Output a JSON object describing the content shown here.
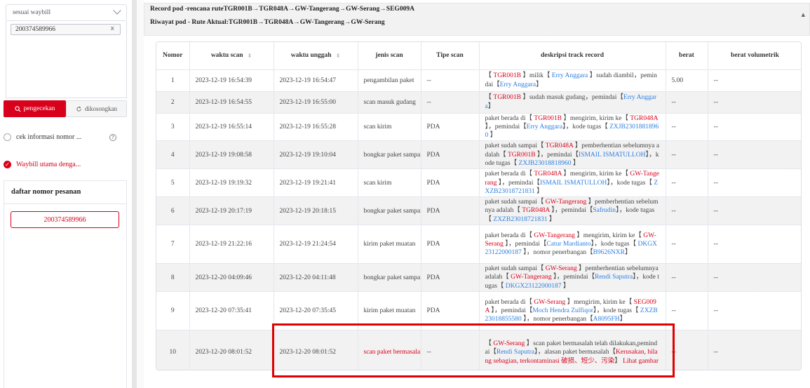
{
  "left": {
    "search_mode": "sesuai waybill",
    "waybill_tag": "200374589966",
    "tag_close": "x",
    "search_btn": "pengecekan",
    "clear_btn": "dikosongkan",
    "option1": "cek informasi nomor ...",
    "option2": "Waybill utama denga...",
    "order_title": "daftar nomor pesanan",
    "order_item": "200374589966"
  },
  "route": {
    "plan": "Record pod -rencana ruteTGR001B→TGR048A→GW-Tangerang→GW-Serang→SEG009A",
    "actual": "Riwayat pod - Rute Aktual:TGR001B→TGR048A→GW-Tangerang→GW-Serang"
  },
  "table": {
    "headers": {
      "nomor": "Nomor",
      "waktu_scan": "waktu scan",
      "waktu_unggah": "waktu unggah",
      "jenis_scan": "jenis scan",
      "tipe_scan": "Tipe scan",
      "deskripsi": "deskripsi track record",
      "berat": "berat",
      "berat_vol": "berat volumetrik"
    },
    "rows": [
      {
        "no": "1",
        "scan": "2023-12-19 16:54:39",
        "unggah": "2023-12-19 16:54:47",
        "jenis": "pengambilan paket",
        "tipe": "--",
        "berat": "5.00",
        "vol": "--",
        "desc": [
          [
            "t",
            "【 "
          ],
          [
            "r",
            "TGR001B"
          ],
          [
            "t",
            " 】milik【 "
          ],
          [
            "b",
            "Erry Anggara"
          ],
          [
            "t",
            " 】sudah diambil，pemindai【"
          ],
          [
            "b",
            "Erry Anggara"
          ],
          [
            "t",
            "】"
          ]
        ]
      },
      {
        "no": "2",
        "scan": "2023-12-19 16:54:55",
        "unggah": "2023-12-19 16:55:00",
        "jenis": "scan masuk gudang",
        "tipe": "--",
        "berat": "--",
        "vol": "--",
        "desc": [
          [
            "t",
            "【 "
          ],
          [
            "r",
            "TGR001B"
          ],
          [
            "t",
            " 】sudah masuk gudang，pemindai【"
          ],
          [
            "b",
            "Erry Anggara"
          ],
          [
            "t",
            "】"
          ]
        ]
      },
      {
        "no": "3",
        "scan": "2023-12-19 16:55:14",
        "unggah": "2023-12-19 16:55:28",
        "jenis": "scan kirim",
        "tipe": "PDA",
        "berat": "--",
        "vol": "--",
        "desc": [
          [
            "t",
            "paket berada di【 "
          ],
          [
            "r",
            "TGR001B"
          ],
          [
            "t",
            " 】mengirim, kirim ke【 "
          ],
          [
            "r",
            "TGR048A"
          ],
          [
            "t",
            " 】，pemindai【"
          ],
          [
            "b",
            "Erry Anggara"
          ],
          [
            "t",
            "】，kode tugas【 "
          ],
          [
            "b",
            "ZXJB23018818960"
          ],
          [
            "t",
            " 】"
          ]
        ]
      },
      {
        "no": "4",
        "scan": "2023-12-19 19:08:58",
        "unggah": "2023-12-19 19:10:04",
        "jenis": "bongkar paket sampai",
        "tipe": "PDA",
        "berat": "--",
        "vol": "--",
        "desc": [
          [
            "t",
            "paket sudah sampai【 "
          ],
          [
            "r",
            "TGR048A"
          ],
          [
            "t",
            " 】pemberhentian sebelumnya adalah【 "
          ],
          [
            "r",
            "TGR001B"
          ],
          [
            "t",
            " 】，pemindai【"
          ],
          [
            "b",
            "ISMAIL ISMATULLOH"
          ],
          [
            "t",
            "】，kode tugas【 "
          ],
          [
            "b",
            "ZXJB23018818960"
          ],
          [
            "t",
            " 】"
          ]
        ]
      },
      {
        "no": "5",
        "scan": "2023-12-19 19:19:32",
        "unggah": "2023-12-19 19:21:41",
        "jenis": "scan kirim",
        "tipe": "PDA",
        "berat": "--",
        "vol": "--",
        "desc": [
          [
            "t",
            "paket berada di【 "
          ],
          [
            "r",
            "TGR048A"
          ],
          [
            "t",
            " 】mengirim, kirim ke【 "
          ],
          [
            "r",
            "GW-Tangerang"
          ],
          [
            "t",
            " 】，pemindai【"
          ],
          [
            "b",
            "ISMAIL ISMATULLOH"
          ],
          [
            "t",
            "】，kode tugas【 "
          ],
          [
            "b",
            "ZXZB23018721831"
          ],
          [
            "t",
            " 】"
          ]
        ]
      },
      {
        "no": "6",
        "scan": "2023-12-19 20:17:19",
        "unggah": "2023-12-19 20:18:15",
        "jenis": "bongkar paket sampai",
        "tipe": "PDA",
        "berat": "--",
        "vol": "--",
        "desc": [
          [
            "t",
            "paket sudah sampai【 "
          ],
          [
            "r",
            "GW-Tangerang"
          ],
          [
            "t",
            " 】pemberhentian sebelumnya adalah【 "
          ],
          [
            "r",
            "TGR048A"
          ],
          [
            "t",
            " 】，pemindai【"
          ],
          [
            "b",
            "Safrudin"
          ],
          [
            "t",
            "】，kode tugas【 "
          ],
          [
            "b",
            "ZXZB23018721831"
          ],
          [
            "t",
            " 】"
          ]
        ]
      },
      {
        "no": "7",
        "scan": "2023-12-19 21:22:16",
        "unggah": "2023-12-19 21:24:54",
        "jenis": "kirim paket muatan",
        "tipe": "PDA",
        "berat": "--",
        "vol": "--",
        "desc": [
          [
            "t",
            "paket berada di【 "
          ],
          [
            "r",
            "GW-Tangerang"
          ],
          [
            "t",
            " 】mengirim, kirim ke【 "
          ],
          [
            "r",
            "GW-Serang"
          ],
          [
            "t",
            " 】，pemindai【"
          ],
          [
            "b",
            "Catur Mardianto"
          ],
          [
            "t",
            "】，kode tugas【 "
          ],
          [
            "b",
            "DKGX23122000187"
          ],
          [
            "t",
            " 】，nomor penerbangan【"
          ],
          [
            "b",
            "B9626NXR"
          ],
          [
            "t",
            "】"
          ]
        ]
      },
      {
        "no": "8",
        "scan": "2023-12-20 04:09:46",
        "unggah": "2023-12-20 04:11:48",
        "jenis": "bongkar paket sampai",
        "tipe": "PDA",
        "berat": "--",
        "vol": "--",
        "desc": [
          [
            "t",
            "paket sudah sampai【 "
          ],
          [
            "r",
            "GW-Serang"
          ],
          [
            "t",
            " 】pemberhentian sebelumnya adalah【 "
          ],
          [
            "r",
            "GW-Tangerang"
          ],
          [
            "t",
            " 】，pemindai【"
          ],
          [
            "b",
            "Rendi Saputra"
          ],
          [
            "t",
            "】，kode tugas【 "
          ],
          [
            "b",
            "DKGX23122000187"
          ],
          [
            "t",
            " 】"
          ]
        ]
      },
      {
        "no": "9",
        "scan": "2023-12-20 07:35:41",
        "unggah": "2023-12-20 07:35:45",
        "jenis": "kirim paket muatan",
        "tipe": "PDA",
        "berat": "--",
        "vol": "--",
        "desc": [
          [
            "t",
            "paket berada di【 "
          ],
          [
            "r",
            "GW-Serang"
          ],
          [
            "t",
            " 】mengirim, kirim ke【 "
          ],
          [
            "r",
            "SEG009A"
          ],
          [
            "t",
            " 】，pemindai【"
          ],
          [
            "b",
            "Moch Hendra Zulfiqor"
          ],
          [
            "t",
            "】，kode tugas【 "
          ],
          [
            "b",
            "ZXZB23018855580"
          ],
          [
            "t",
            " 】，nomor penerbangan【"
          ],
          [
            "b",
            "A8095FH"
          ],
          [
            "t",
            "】"
          ]
        ]
      },
      {
        "no": "10",
        "scan": "2023-12-20 08:01:52",
        "unggah": "2023-12-20 08:01:52",
        "jenis": "scan paket bermasalah",
        "tipe": "--",
        "berat": "--",
        "vol": "--",
        "red": true,
        "desc": [
          [
            "t",
            "【 "
          ],
          [
            "r",
            "GW-Serang"
          ],
          [
            "t",
            " 】scan paket bermasalah telah dilakukan,pemindai【"
          ],
          [
            "b",
            "Rendi Saputra"
          ],
          [
            "t",
            "】，alasan paket bermasalah【"
          ],
          [
            "r",
            "Kerusakan, hilang sebagian, terkontaminasi 破损、短少、污染"
          ],
          [
            "t",
            "】  "
          ],
          [
            "r",
            "Lihat gambar"
          ]
        ]
      }
    ]
  }
}
